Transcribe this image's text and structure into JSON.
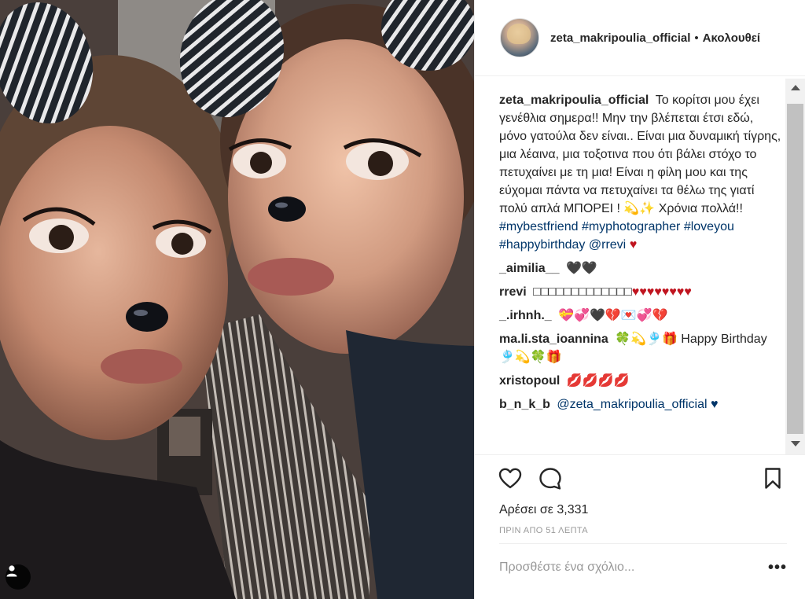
{
  "post": {
    "author": "zeta_makripoulia_official",
    "separator": "•",
    "follow_label": "Ακολουθεί",
    "caption_user": "zeta_makripoulia_official",
    "caption_text": "Το κορίτσι μου έχει γενέθλια σημερα!! Μην την βλέπεται έτσι εδώ, μόνο γατούλα δεν είναι.. Είναι μια δυναμική τίγρης, μια λέαινα, μια τοξοτινα που ότι βάλει στόχο το πετυχαίνει με τη μια! Είναι η φίλη μου και της εύχομαι πάντα να πετυχαίνει τα θέλω της γιατί πολύ απλά ΜΠΟΡΕΙ ! 💫✨ Χρόνια πολλά!!",
    "caption_tags": [
      "#mybestfriend",
      "#myphotographer",
      "#loveyou",
      "#happybirthday",
      "@rrevi"
    ],
    "caption_end": "♥"
  },
  "comments": [
    {
      "user": "_aimilia__",
      "text": "🖤🖤"
    },
    {
      "user": "rrevi",
      "text": "□□□□□□□□□□□□□",
      "hearts": "♥♥♥♥♥♥♥♥"
    },
    {
      "user": "_.irhnh._",
      "text": "💝💞🖤💔💌💞💔"
    },
    {
      "user": "ma.li.sta_ioannina",
      "text": "🍀💫🎐🎁 Happy Birthday 🎐💫🍀🎁"
    },
    {
      "user": "xristopoul",
      "text": "💋💋💋💋"
    },
    {
      "user": "b_n_k_b",
      "text": "@zeta_makripoulia_official ♥"
    }
  ],
  "actions": {
    "like_icon": "heart-icon",
    "comment_icon": "comment-icon",
    "save_icon": "bookmark-icon",
    "likes_text": "Αρέσει σε 3,331",
    "time_ago": "ΠΡΙΝ ΑΠΟ 51 ΛΕΠΤΑ",
    "add_comment_placeholder": "Προσθέστε ένα σχόλιο...",
    "more_label": "•••"
  },
  "photo": {
    "tag_icon": "user-tag-icon"
  },
  "colors": {
    "text": "#262626",
    "link": "#003569",
    "muted": "#999999",
    "heart": "#c0141f"
  }
}
